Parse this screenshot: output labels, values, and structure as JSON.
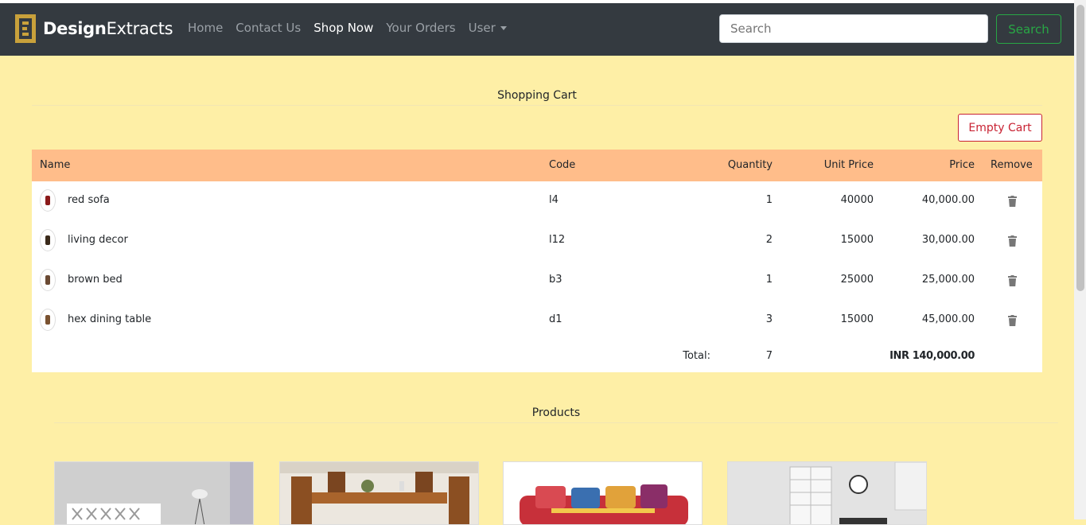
{
  "brand": {
    "name_bold": "Design",
    "name_rest": "Extracts",
    "accent": "#c9a13b"
  },
  "nav": {
    "links": [
      "Home",
      "Contact Us",
      "Shop Now",
      "Your Orders",
      "User"
    ],
    "active": "Shop Now"
  },
  "search": {
    "placeholder": "Search",
    "button": "Search"
  },
  "cart": {
    "title": "Shopping Cart",
    "empty_button": "Empty Cart",
    "headers": {
      "name": "Name",
      "code": "Code",
      "quantity": "Quantity",
      "unit_price": "Unit Price",
      "price": "Price",
      "remove": "Remove"
    },
    "rows": [
      {
        "name": "red sofa",
        "code": "l4",
        "quantity": "1",
        "unit_price": "40000",
        "price": "40,000.00"
      },
      {
        "name": "living decor",
        "code": "l12",
        "quantity": "2",
        "unit_price": "15000",
        "price": "30,000.00"
      },
      {
        "name": "brown bed",
        "code": "b3",
        "quantity": "1",
        "unit_price": "25000",
        "price": "25,000.00"
      },
      {
        "name": "hex dining table",
        "code": "d1",
        "quantity": "3",
        "unit_price": "15000",
        "price": "45,000.00"
      }
    ],
    "total_label": "Total:",
    "total_quantity": "7",
    "total_price": "INR 140,000.00"
  },
  "products": {
    "title": "Products"
  },
  "colors": {
    "page_bg": "#feefa6",
    "navbar": "#343a40",
    "table_header": "#ffbd8a",
    "search_green": "#28a745",
    "danger_red": "#c82333"
  }
}
